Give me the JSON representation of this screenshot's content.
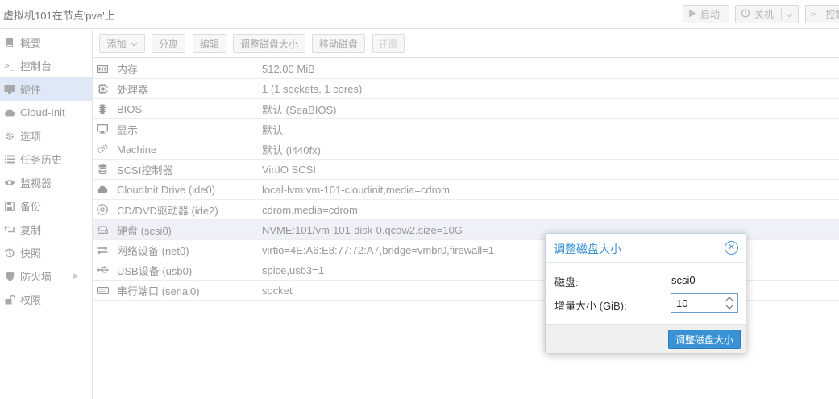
{
  "header": {
    "title": "虚拟机101在节点'pve'上",
    "start_label": "启动",
    "shutdown_label": "关机",
    "console_label": "控制"
  },
  "sidebar": {
    "items": [
      {
        "label": "概要",
        "icon": "book-icon"
      },
      {
        "label": "控制台",
        "icon": "terminal-icon"
      },
      {
        "label": "硬件",
        "icon": "desktop-icon"
      },
      {
        "label": "Cloud-Init",
        "icon": "cloud-icon"
      },
      {
        "label": "选项",
        "icon": "gear-icon"
      },
      {
        "label": "任务历史",
        "icon": "list-icon"
      },
      {
        "label": "监视器",
        "icon": "eye-icon"
      },
      {
        "label": "备份",
        "icon": "floppy-icon"
      },
      {
        "label": "复制",
        "icon": "retweet-icon"
      },
      {
        "label": "快照",
        "icon": "history-icon"
      },
      {
        "label": "防火墙",
        "icon": "shield-icon"
      },
      {
        "label": "权限",
        "icon": "unlock-icon"
      }
    ]
  },
  "toolbar": {
    "add_label": "添加",
    "detach_label": "分离",
    "edit_label": "编辑",
    "resize_label": "调整磁盘大小",
    "move_label": "移动磁盘",
    "revert_label": "还原"
  },
  "hardware": [
    {
      "icon": "memory-icon",
      "name": "内存",
      "value": "512.00 MiB"
    },
    {
      "icon": "cpu-icon",
      "name": "处理器",
      "value": "1 (1 sockets, 1 cores)"
    },
    {
      "icon": "microchip-icon",
      "name": "BIOS",
      "value": "默认 (SeaBIOS)"
    },
    {
      "icon": "monitor-icon",
      "name": "显示",
      "value": "默认"
    },
    {
      "icon": "cogs-icon",
      "name": "Machine",
      "value": "默认 (i440fx)"
    },
    {
      "icon": "database-icon",
      "name": "SCSI控制器",
      "value": "VirtIO SCSI"
    },
    {
      "icon": "cloud-icon",
      "name": "CloudInit Drive (ide0)",
      "value": "local-lvm:vm-101-cloudinit,media=cdrom"
    },
    {
      "icon": "cd-icon",
      "name": "CD/DVD驱动器 (ide2)",
      "value": "cdrom,media=cdrom"
    },
    {
      "icon": "hdd-icon",
      "name": "硬盘 (scsi0)",
      "value": "NVME:101/vm-101-disk-0.qcow2,size=10G"
    },
    {
      "icon": "exchange-icon",
      "name": "网络设备 (net0)",
      "value": "virtio=4E:A6:E8:77:72:A7,bridge=vmbr0,firewall=1"
    },
    {
      "icon": "usb-icon",
      "name": "USB设备 (usb0)",
      "value": "spice,usb3=1"
    },
    {
      "icon": "keyboard-icon",
      "name": "串行端口 (serial0)",
      "value": "socket"
    }
  ],
  "dialog": {
    "title": "调整磁盘大小",
    "disk_label": "磁盘:",
    "disk_value": "scsi0",
    "increment_label": "增量大小 (GiB):",
    "increment_value": "10",
    "submit_label": "调整磁盘大小"
  },
  "colors": {
    "accent": "#3892d4",
    "selected_nav": "#dfe8f6"
  }
}
